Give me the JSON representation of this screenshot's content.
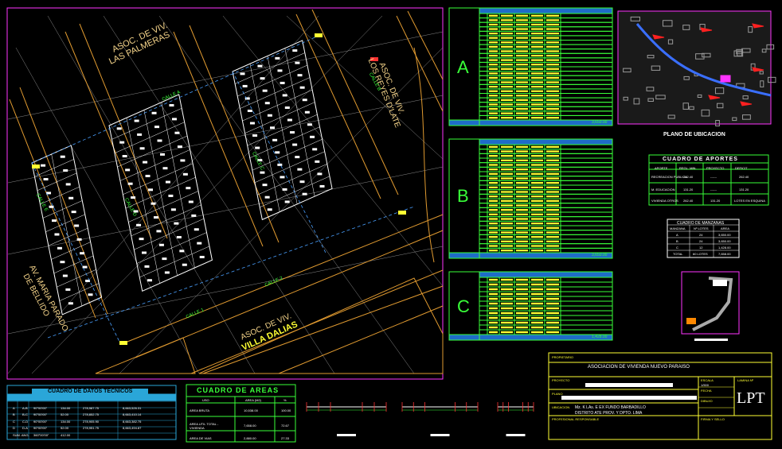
{
  "map": {
    "assoc_palmeras": [
      "ASOC. DE VIV.",
      "LAS PALMERAS"
    ],
    "assoc_reyes": [
      "ASOC. DE VIV.",
      "LOS REYES D'LATE"
    ],
    "assoc_dalias": [
      "ASOC. DE VIV.",
      "VILLA DALIAS"
    ],
    "avenue": [
      "AV. MARIA PARADO",
      "DE BELLIDO"
    ],
    "streets": [
      "CALLE A",
      "CALLE B",
      "CALLE C",
      "CALLE D",
      "CALLE E",
      "CALLE 1",
      "CALLE 2"
    ]
  },
  "blocks": [
    {
      "letter": "A",
      "rows": 24,
      "total": "3,650.00"
    },
    {
      "letter": "B",
      "rows": 24,
      "total": "3,650.00"
    },
    {
      "letter": "C",
      "rows": 12,
      "total": "1,428.00"
    }
  ],
  "location": {
    "caption": "PLANO DE UBICACION"
  },
  "aportes": {
    "title": "CUADRO DE APORTES",
    "headers": [
      "APORTE",
      "REGL. MIN.",
      "PROYECTO",
      "DEFICIT"
    ],
    "rows": [
      [
        "RECREACION PUBLICA",
        "262.40",
        "------",
        "262.40"
      ],
      [
        "M. EDUCACION",
        "131.20",
        "------",
        "131.20"
      ],
      [
        "VIVIENDA OTROS",
        "262.40",
        "131.20",
        "LOTES EN ESQUINA"
      ]
    ]
  },
  "manzanas": {
    "title": "CUADRO DE MANZANAS",
    "headers": [
      "MANZANA",
      "Nº LOTES",
      "AREA"
    ],
    "rows": [
      [
        "A",
        "24",
        "3,650.00"
      ],
      [
        "B",
        "24",
        "3,650.00"
      ],
      [
        "C",
        "12",
        "1,428.00"
      ]
    ],
    "total": [
      "TOTAL",
      "60 LOTES",
      "7,658.00"
    ]
  },
  "tecnicos": {
    "title": "CUADRO DE DATOS TECNICOS",
    "rows": [
      [
        "A",
        "A-B",
        "90°00'00\"",
        "134.00",
        "278,987.75",
        "8,663,526.31"
      ],
      [
        "B",
        "B-C",
        "90°00'00\"",
        "52.00",
        "278,852.75",
        "8,663,410.14"
      ],
      [
        "C",
        "C-D",
        "90°00'00\"",
        "134.00",
        "278,905.90",
        "8,663,382.75"
      ],
      [
        "D",
        "D-A",
        "90°00'00\"",
        "52.00",
        "278,951.75",
        "8,663,494.87"
      ]
    ],
    "sum": [
      "SUM. ANG.",
      "360°00'00\"",
      "",
      "412.00"
    ]
  },
  "areas": {
    "title": "CUADRO DE AREAS",
    "headers": [
      "USO",
      "AREA (M2)",
      "%"
    ],
    "rows": [
      [
        "AREA BRUTA",
        "10,538.00",
        "100.00"
      ],
      [
        "AREA UTIL TOTAL - VIVIENDA",
        "7,658.00",
        "72.67"
      ],
      [
        "AREA DE VIAS",
        "2,880.00",
        "27.33"
      ]
    ]
  },
  "titleblock": {
    "owner_label": "PROPIETARIO",
    "owner": "ASOCIACION DE VIVIENDA NUEVO PARAISO",
    "project_label": "PROYECTO",
    "plan_label": "PLANO",
    "location_label": "UBICACION",
    "location_line1": "Mz. K LAs. E EX FUNDO BARBADILLO",
    "location_line2": "DISTRITO  ATE   PROV. Y   DPTO. LIMA",
    "professional_label": "PROFESIONAL RESPONSABLE",
    "scale_label": "ESCALA",
    "scale": "1/500",
    "date_label": "FECHA",
    "drawn_label": "DIBUJO",
    "sheet_label": "LAMINA Nº",
    "sheet": "LPT",
    "signature_label": "FIRMA Y SELLO"
  }
}
